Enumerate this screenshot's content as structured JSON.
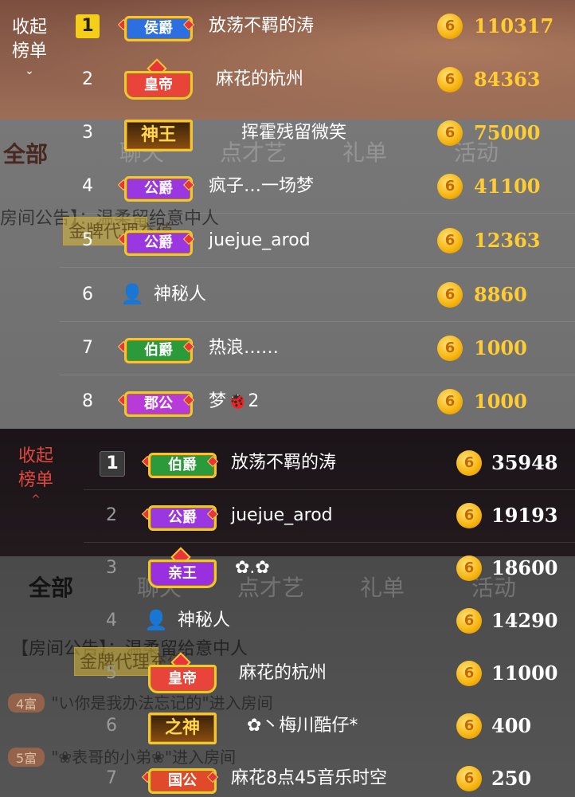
{
  "colors": {
    "gold": "#ffcc33",
    "badge_hou": "#2b6fe0",
    "badge_emperor": "#e8443a",
    "badge_gong": "#9b37e0",
    "badge_bo": "#2b9a3a",
    "badge_jungong": "#b83ad8",
    "badge_qinwang": "#9a2fe0",
    "badge_guogong": "#e04a2a",
    "collapse_red": "#e0483c"
  },
  "panel1": {
    "collapse": {
      "line1": "收起",
      "line2": "榜单",
      "icon": "chevron-down-icon",
      "chevron": "⌄"
    },
    "background": {
      "tabs": [
        "聊天",
        "点才艺",
        "礼单",
        "活动"
      ],
      "all_label": "全部",
      "notice_prefix": "房间公告】：",
      "notice_badge": "金牌代理充值",
      "notice_text": "温柔留给意中人"
    },
    "rows": [
      {
        "rank": "1",
        "badge": "侯爵",
        "name": "放荡不羁的涛",
        "amount": "110317"
      },
      {
        "rank": "2",
        "badge": "皇帝",
        "name": "麻花的杭州",
        "amount": "84363"
      },
      {
        "rank": "3",
        "badge": "神王",
        "name": "挥霍残留微笑",
        "amount": "75000"
      },
      {
        "rank": "4",
        "badge": "公爵",
        "name": "疯子…一场梦",
        "amount": "41100"
      },
      {
        "rank": "5",
        "badge": "公爵",
        "name": "juejue_arod",
        "amount": "12363"
      },
      {
        "rank": "6",
        "badge": "",
        "badge_icon": "mystery-person-icon",
        "name": "神秘人",
        "amount": "8860"
      },
      {
        "rank": "7",
        "badge": "伯爵",
        "name": "热浪……",
        "amount": "1000"
      },
      {
        "rank": "8",
        "badge": "郡公",
        "name": "梦🐞2",
        "amount": "1000"
      }
    ],
    "coin_glyph": "6"
  },
  "panel2": {
    "collapse": {
      "line1": "收起",
      "line2": "榜单",
      "icon": "chevron-up-icon",
      "chevron": "^"
    },
    "background": {
      "tabs": [
        "聊天",
        "点才艺",
        "礼单",
        "活动"
      ],
      "all_label": "全部",
      "notice_prefix": "【房间公告】：",
      "notice_badge": "金牌代理充值",
      "notice_text": "温柔留给意中人",
      "entry1_pill": "4富",
      "entry1_text": "\"い你是我办法忘记的\"进入房间",
      "entry2_pill": "5富",
      "entry2_text": "\"❀表哥的小弟❀\"进入房间"
    },
    "rows": [
      {
        "rank": "1",
        "badge": "伯爵",
        "name": "放荡不羁的涛",
        "amount": "35948"
      },
      {
        "rank": "2",
        "badge": "公爵",
        "name": "juejue_arod",
        "amount": "19193"
      },
      {
        "rank": "3",
        "badge": "亲王",
        "name": "✿.✿",
        "amount": "18600"
      },
      {
        "rank": "4",
        "badge": "",
        "badge_icon": "mystery-person-icon",
        "name": "神秘人",
        "amount": "14290"
      },
      {
        "rank": "5",
        "badge": "皇帝",
        "name": "麻花的杭州",
        "amount": "11000"
      },
      {
        "rank": "6",
        "badge": "之神",
        "name": "✿丶梅川酷仔*",
        "amount": "400"
      },
      {
        "rank": "7",
        "badge": "国公",
        "name": "麻花8点45音乐时空",
        "amount": "250"
      }
    ],
    "coin_glyph": "6"
  }
}
